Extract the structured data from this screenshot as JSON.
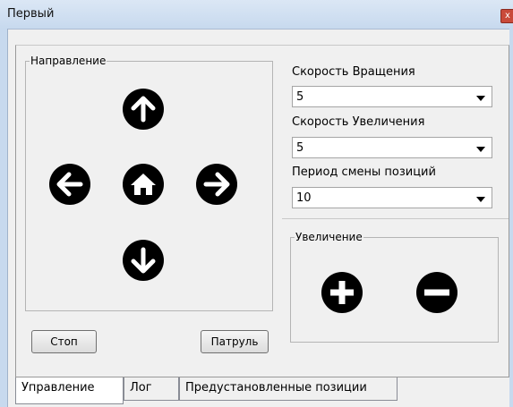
{
  "window": {
    "title": "Первый",
    "close_label": "x"
  },
  "direction": {
    "group_title": "Направление",
    "buttons": [
      "up",
      "left",
      "home",
      "right",
      "down"
    ]
  },
  "controls": {
    "stop_label": "Стоп",
    "patrol_label": "Патруль"
  },
  "settings": {
    "rotation_speed_label": "Скорость Вращения",
    "rotation_speed_value": "5",
    "zoom_speed_label": "Скорость Увеличения",
    "zoom_speed_value": "5",
    "position_period_label": "Период смены позиций",
    "position_period_value": "10"
  },
  "zoom": {
    "group_title": "Увеличение"
  },
  "tabs": [
    {
      "label": "Управление",
      "active": true
    },
    {
      "label": "Лог",
      "active": false
    },
    {
      "label": "Предустановленные позиции",
      "active": false
    }
  ],
  "colors": {
    "titlebar": "#c7d9ee",
    "panel": "#f0f0f0",
    "icon": "#000000"
  }
}
